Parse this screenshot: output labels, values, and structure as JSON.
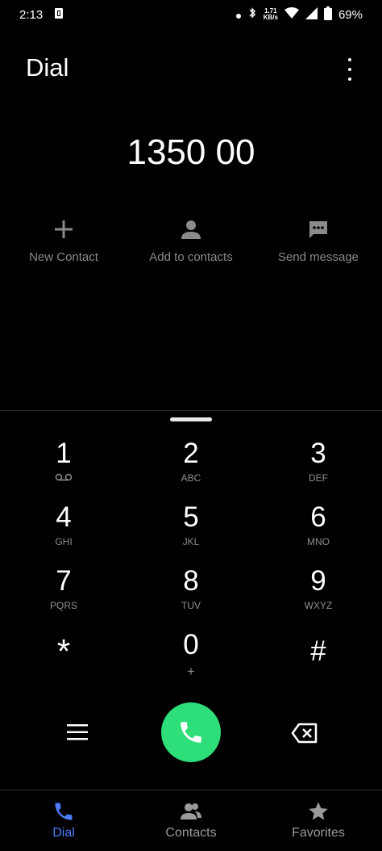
{
  "status_bar": {
    "time": "2:13",
    "net_speed_value": "1.71",
    "net_speed_unit": "KB/s",
    "battery": "69%"
  },
  "header": {
    "title": "Dial"
  },
  "dialed_number": "1350 00",
  "actions": [
    {
      "label": "New Contact",
      "icon": "plus-icon"
    },
    {
      "label": "Add to contacts",
      "icon": "person-icon"
    },
    {
      "label": "Send message",
      "icon": "message-icon"
    }
  ],
  "keypad": [
    {
      "digit": "1",
      "letters": ""
    },
    {
      "digit": "2",
      "letters": "ABC"
    },
    {
      "digit": "3",
      "letters": "DEF"
    },
    {
      "digit": "4",
      "letters": "GHI"
    },
    {
      "digit": "5",
      "letters": "JKL"
    },
    {
      "digit": "6",
      "letters": "MNO"
    },
    {
      "digit": "7",
      "letters": "PQRS"
    },
    {
      "digit": "8",
      "letters": "TUV"
    },
    {
      "digit": "9",
      "letters": "WXYZ"
    },
    {
      "digit": "*",
      "letters": ""
    },
    {
      "digit": "0",
      "letters": "+"
    },
    {
      "digit": "#",
      "letters": ""
    }
  ],
  "bottom_nav": [
    {
      "label": "Dial",
      "icon": "phone-icon",
      "active": true
    },
    {
      "label": "Contacts",
      "icon": "contacts-icon",
      "active": false
    },
    {
      "label": "Favorites",
      "icon": "star-icon",
      "active": false
    }
  ],
  "colors": {
    "background": "#000000",
    "call_button": "#2ede79",
    "active_tab": "#4d7cff",
    "secondary_text": "#8a8a8a"
  }
}
